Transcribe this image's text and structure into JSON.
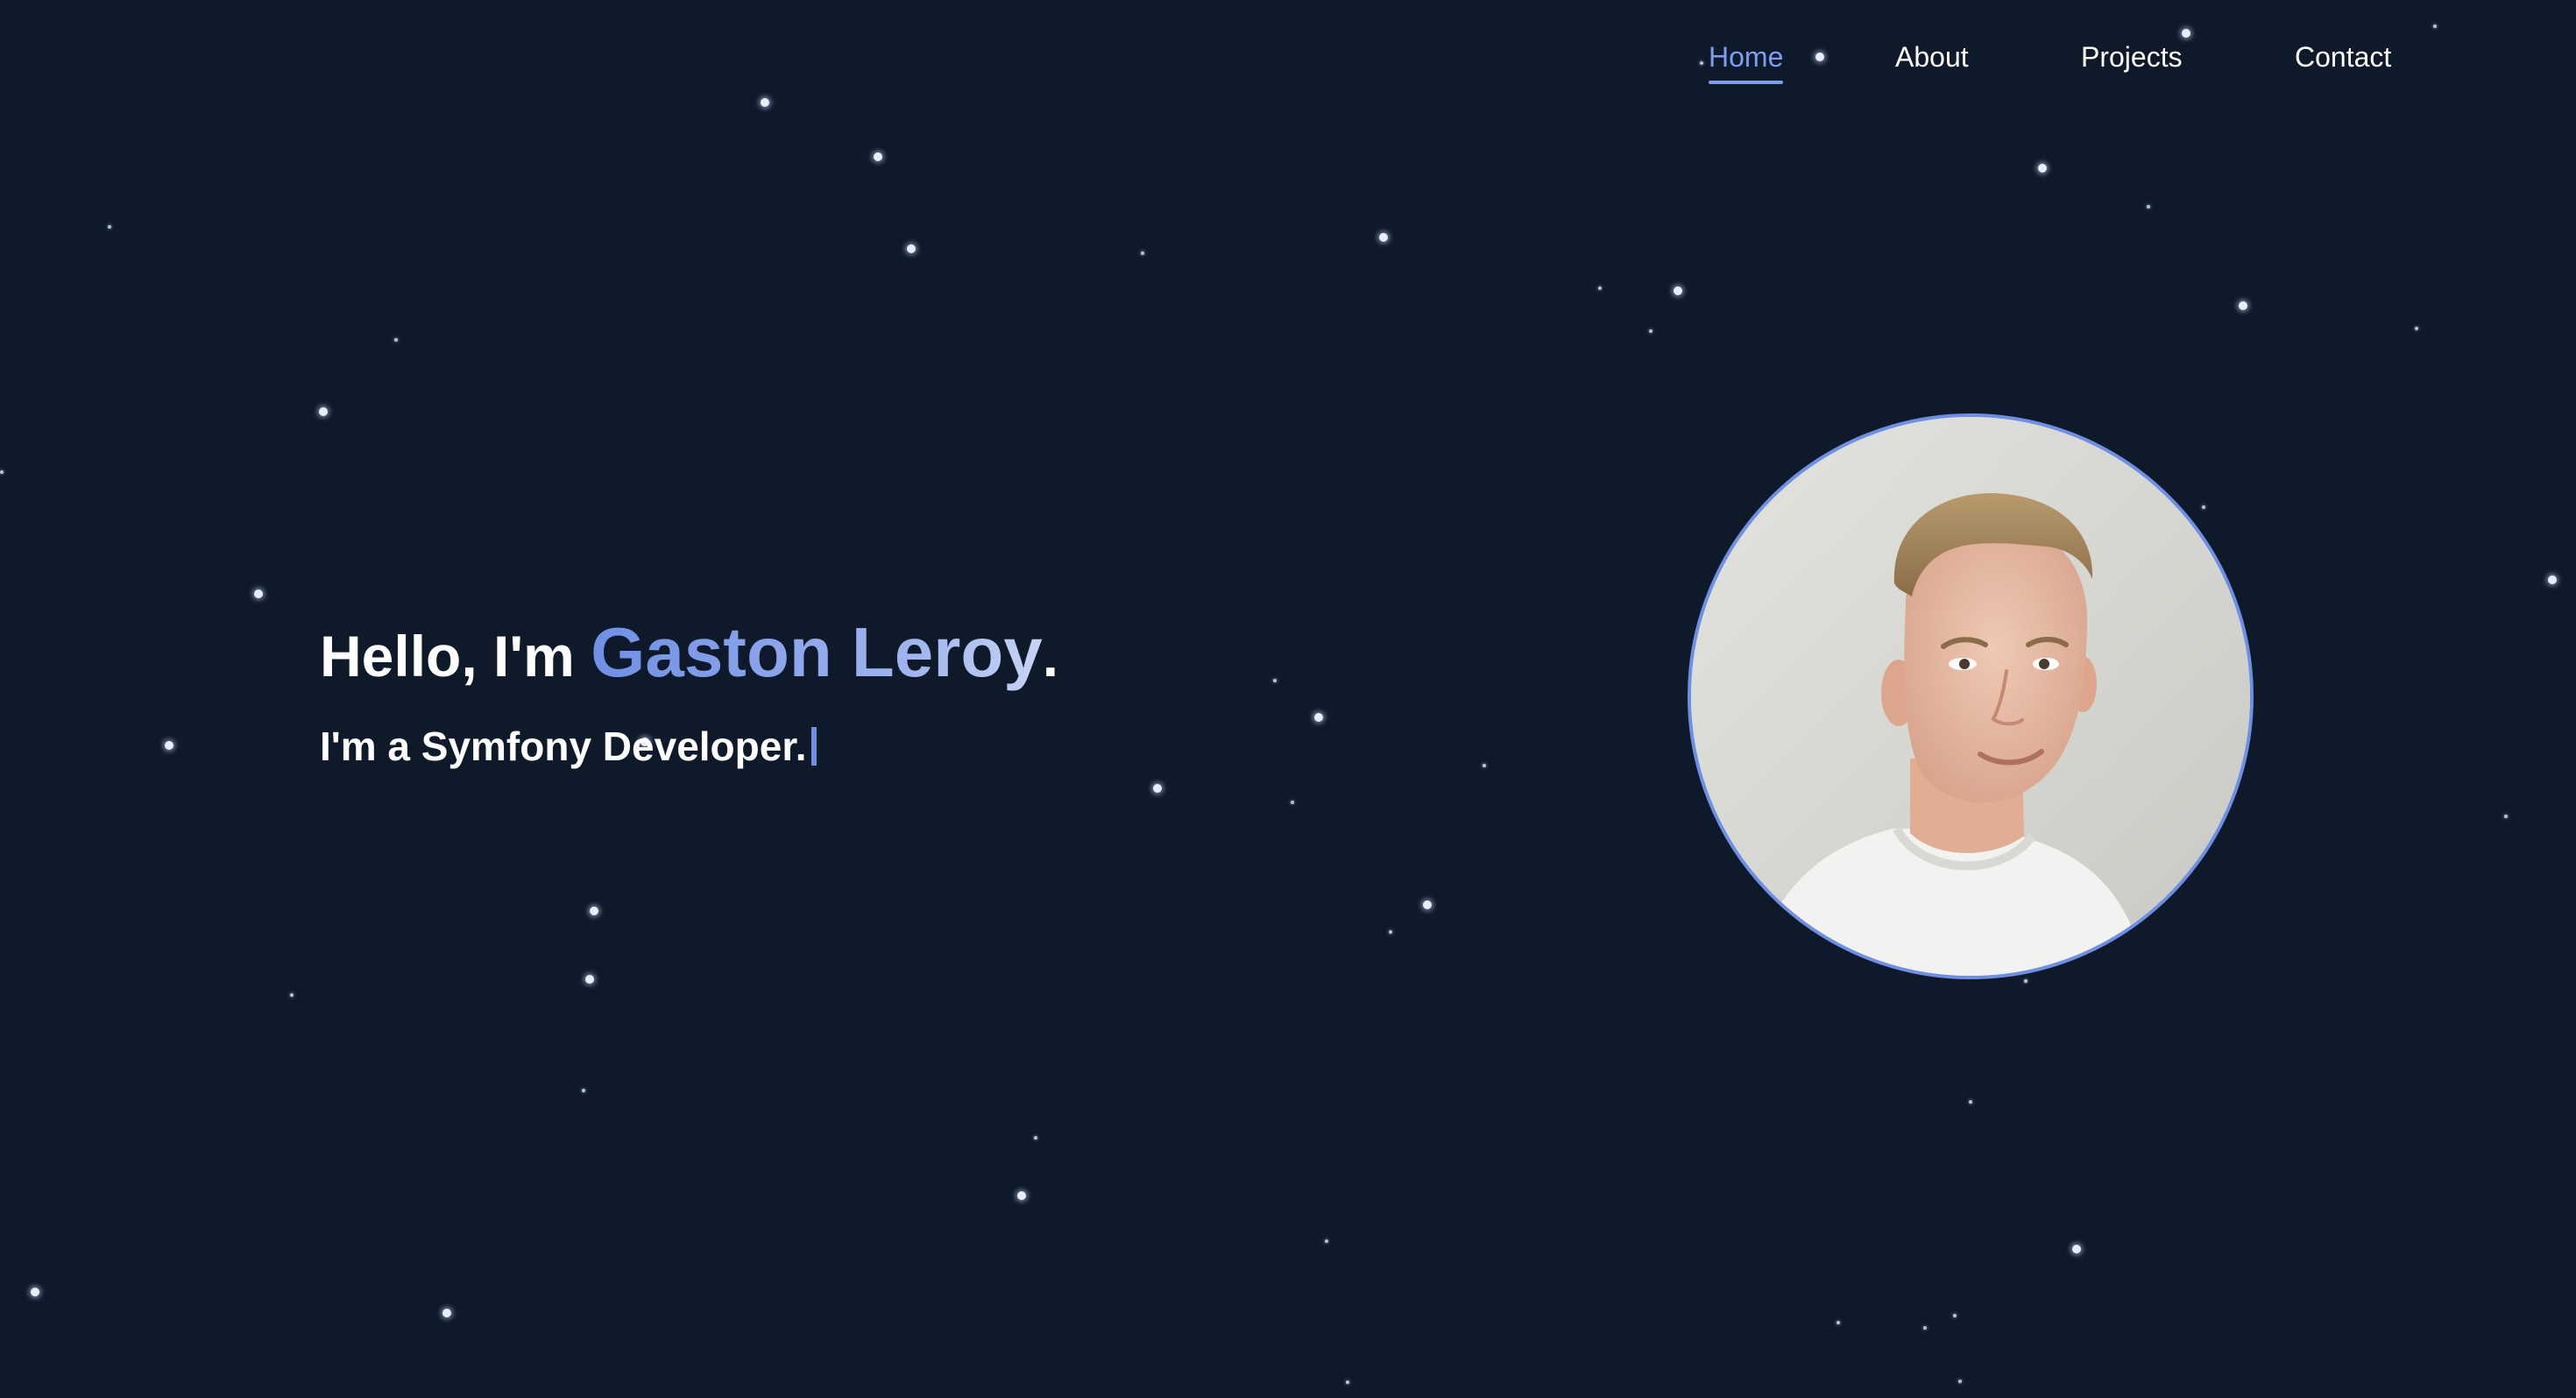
{
  "nav": {
    "items": [
      {
        "label": "Home",
        "active": true
      },
      {
        "label": "About",
        "active": false
      },
      {
        "label": "Projects",
        "active": false
      },
      {
        "label": "Contact",
        "active": false
      }
    ]
  },
  "hero": {
    "greeting": "Hello, I'm ",
    "name": "Gaston Leroy",
    "punctuation": ".",
    "role": "I'm a Symfony Developer."
  },
  "colors": {
    "background": "#0e1a2a",
    "accent": "#7c9ef0",
    "text": "#ffffff"
  },
  "avatar": {
    "icon": "portrait-photo"
  }
}
